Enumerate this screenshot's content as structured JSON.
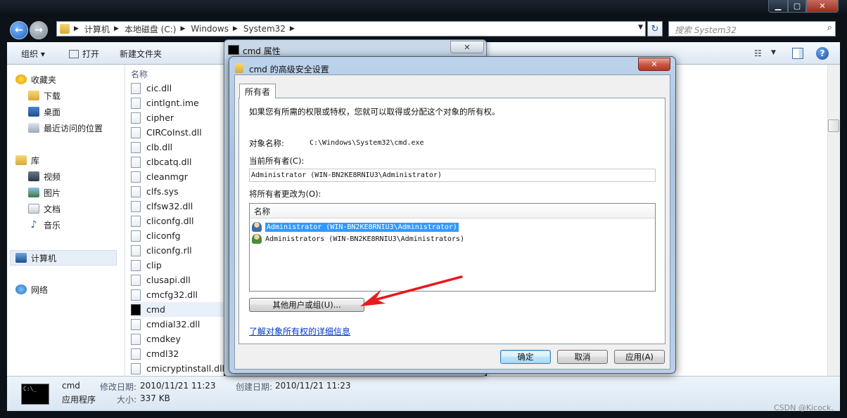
{
  "window": {
    "minimize_glyph": "▁",
    "maximize_glyph": "▢",
    "close_glyph": "✕"
  },
  "address": {
    "crumbs": [
      "计算机",
      "本地磁盘 (C:)",
      "Windows",
      "System32"
    ],
    "separator": "▶"
  },
  "search": {
    "placeholder": "搜索 System32"
  },
  "commandbar": {
    "organize": "组织 ▾",
    "open": "打开",
    "new_folder": "新建文件夹"
  },
  "navpane": {
    "favorites": "收藏夹",
    "favorites_items": [
      "下载",
      "桌面",
      "最近访问的位置"
    ],
    "libraries": "库",
    "library_items": [
      "视频",
      "图片",
      "文档",
      "音乐"
    ],
    "computer": "计算机",
    "network": "网络"
  },
  "filelist": {
    "column_name": "名称",
    "files": [
      "cic.dll",
      "cintlgnt.ime",
      "cipher",
      "CIRCoInst.dll",
      "clb.dll",
      "clbcatq.dll",
      "cleanmgr",
      "clfs.sys",
      "clfsw32.dll",
      "cliconfg.dll",
      "cliconfg",
      "cliconfg.rll",
      "clip",
      "clusapi.dll",
      "cmcfg32.dll",
      "cmd",
      "cmdial32.dll",
      "cmdkey",
      "cmdl32",
      "cmicryptinstall.dll"
    ],
    "selected_index": 15
  },
  "details": {
    "name": "cmd",
    "type": "应用程序",
    "modified_label": "修改日期:",
    "modified_value": "2010/11/21 11:23",
    "created_label": "创建日期:",
    "created_value": "2010/11/21 11:23",
    "size_label": "大小:",
    "size_value": "337 KB",
    "thumb_text": "C:\\_"
  },
  "props_dialog": {
    "title": "cmd 属性",
    "close_glyph": "✕"
  },
  "adv_dialog": {
    "title": "cmd 的高级安全设置",
    "close_glyph": "✕",
    "tab": "所有者",
    "intro": "如果您有所需的权限或特权，您就可以取得或分配这个对象的所有权。",
    "object_name_label": "对象名称:",
    "object_name_value": "C:\\Windows\\System32\\cmd.exe",
    "current_owner_label": "当前所有者(C):",
    "current_owner_value": "Administrator (WIN-BN2KE8RNIU3\\Administrator)",
    "change_owner_label": "将所有者更改为(O):",
    "list_header": "名称",
    "owners": [
      "Administrator (WIN-BN2KE8RNIU3\\Administrator)",
      "Administrators (WIN-BN2KE8RNIU3\\Administrators)"
    ],
    "other_users_button": "其他用户或组(U)...",
    "learn_link": "了解对象所有权的详细信息",
    "ok": "确定",
    "cancel": "取消",
    "apply": "应用(A)"
  },
  "watermark": "CSDN @Kicock.",
  "colors": {
    "selection": "#3399ff",
    "link": "#0033cc",
    "arrow": "#e8191d"
  }
}
